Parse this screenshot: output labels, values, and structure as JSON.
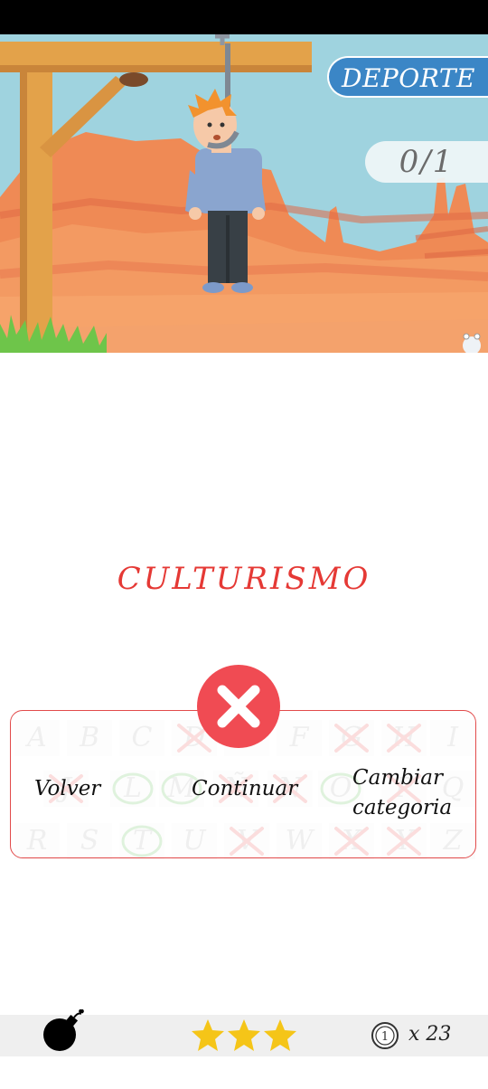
{
  "header": {
    "category": "DEPORTE",
    "score": "0/1"
  },
  "word": "CULTURISMO",
  "keyboard": {
    "keys": [
      {
        "letter": "A",
        "state": "unused"
      },
      {
        "letter": "B",
        "state": "unused"
      },
      {
        "letter": "C",
        "state": "unused"
      },
      {
        "letter": "D",
        "state": "wrong"
      },
      {
        "letter": "E",
        "state": "unused"
      },
      {
        "letter": "F",
        "state": "unused"
      },
      {
        "letter": "G",
        "state": "wrong"
      },
      {
        "letter": "H",
        "state": "wrong"
      },
      {
        "letter": "I",
        "state": "unused"
      },
      {
        "letter": "J",
        "state": "wrong"
      },
      {
        "letter": "L",
        "state": "correct"
      },
      {
        "letter": "M",
        "state": "correct"
      },
      {
        "letter": "Ñ",
        "state": "wrong"
      },
      {
        "letter": "N",
        "state": "wrong"
      },
      {
        "letter": "O",
        "state": "correct"
      },
      {
        "letter": "P",
        "state": "wrong"
      },
      {
        "letter": "Q",
        "state": "unused"
      },
      {
        "letter": "R",
        "state": "unused"
      },
      {
        "letter": "S",
        "state": "unused"
      },
      {
        "letter": "T",
        "state": "correct"
      },
      {
        "letter": "U",
        "state": "unused"
      },
      {
        "letter": "V",
        "state": "wrong"
      },
      {
        "letter": "W",
        "state": "unused"
      },
      {
        "letter": "X",
        "state": "wrong"
      },
      {
        "letter": "Y",
        "state": "wrong"
      },
      {
        "letter": "Z",
        "state": "unused"
      }
    ]
  },
  "dialog": {
    "icon": "close-x-icon",
    "back_label": "Volver",
    "continue_label": "Continuar",
    "change_label_line1": "Cambiar",
    "change_label_line2": "categoria"
  },
  "footer": {
    "bomb_icon": "bomb-icon",
    "stars": 3,
    "coin_icon": "coin-icon",
    "coins": "x 23"
  },
  "colors": {
    "accent_red": "#e53935",
    "category_blue": "#3b86c6",
    "star": "#f5c518",
    "sky": "#9fd3df",
    "desert": "#f08a55"
  }
}
